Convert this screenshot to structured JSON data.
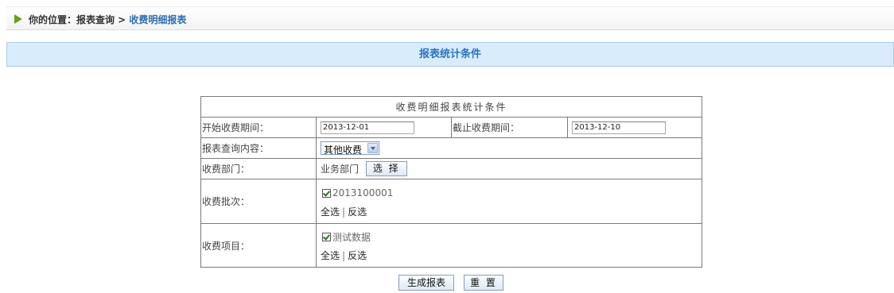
{
  "breadcrumb": {
    "prefix": "你的位置：报表查询 > ",
    "current": "收费明细报表"
  },
  "section_title": "报表统计条件",
  "form": {
    "caption": "收费明细报表统计条件",
    "start_label": "开始收费期间：",
    "start_value": "2013-12-01",
    "end_label": "截止收费期间：",
    "end_value": "2013-12-10",
    "content_label": "报表查询内容：",
    "content_selected": "其他收费",
    "dept_label": "收费部门：",
    "dept_value": "业务部门",
    "dept_button": "选 择",
    "batch_label": "收费批次：",
    "batch_item": "2013100001",
    "item_label": "收费项目：",
    "item_item": "测试数据",
    "select_all": "全选",
    "separator": "|",
    "invert": "反选"
  },
  "actions": {
    "generate": "生成报表",
    "reset": "重 置"
  },
  "colors": {
    "accent": "#2a74c4",
    "section_bg": "#d9ecfb",
    "arrow": "#6aa01c"
  }
}
